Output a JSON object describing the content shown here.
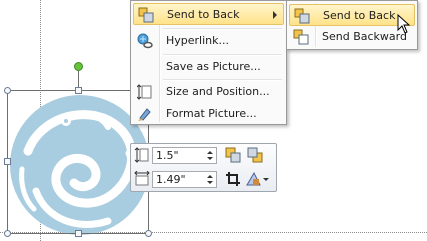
{
  "context_menu": {
    "items": [
      {
        "label": "Send to Back",
        "icon": "send-to-back-icon",
        "has_submenu": true,
        "highlighted": true
      },
      {
        "label": "Hyperlink...",
        "icon": "hyperlink-icon"
      },
      {
        "label": "Save as Picture...",
        "icon": ""
      },
      {
        "label": "Size and Position...",
        "icon": "size-position-icon"
      },
      {
        "label": "Format Picture...",
        "icon": "format-picture-icon"
      }
    ]
  },
  "submenu": {
    "items": [
      {
        "label": "Send to Back",
        "icon": "send-to-back-icon",
        "highlighted": true
      },
      {
        "label": "Send Backward",
        "icon": "send-backward-icon"
      }
    ]
  },
  "mini_toolbar": {
    "height_value": "1.5\"",
    "width_value": "1.49\"",
    "icons": [
      "shape-height-icon",
      "bring-forward-icon",
      "send-backward-icon",
      "shape-width-icon",
      "crop-icon",
      "change-shape-icon"
    ]
  },
  "colors": {
    "menu_highlight": "#ffe38a",
    "picture_fill": "#a9cde0",
    "rotate_handle": "#66c13c"
  }
}
